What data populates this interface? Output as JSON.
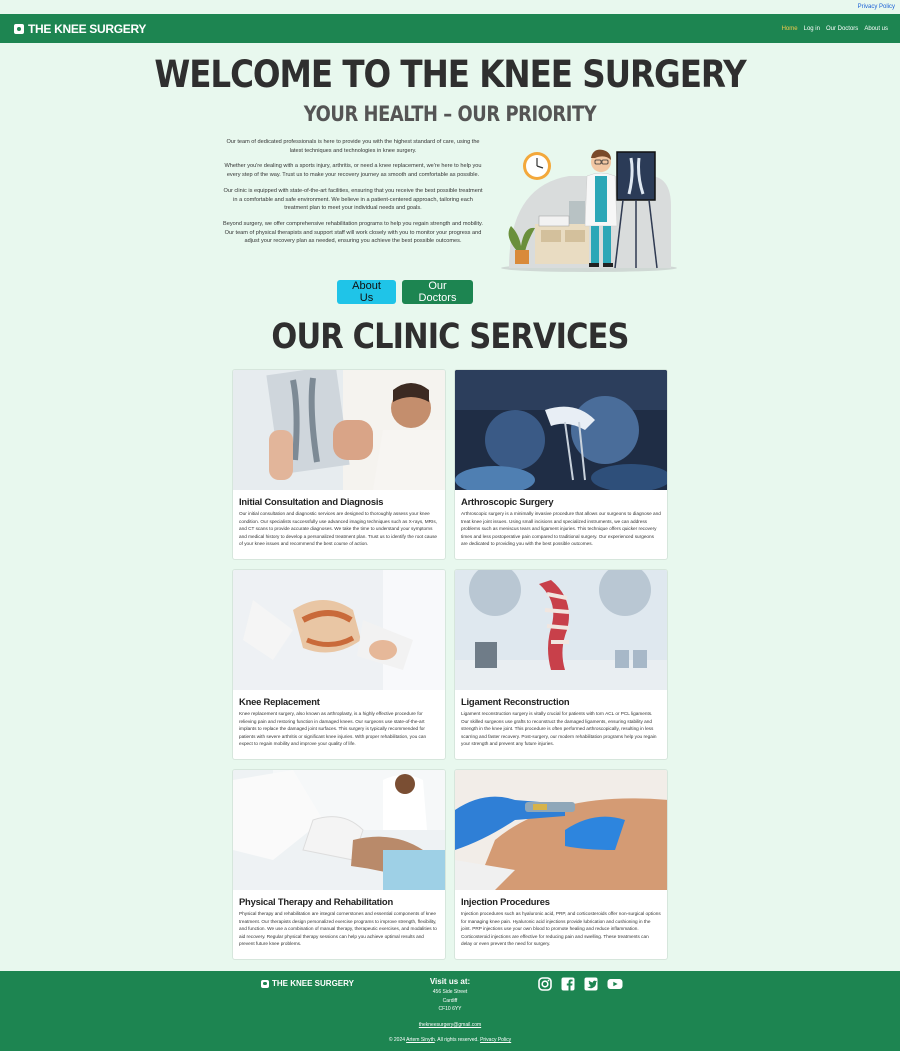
{
  "topbar": {
    "privacy": "Privacy Policy"
  },
  "nav": {
    "brand": "THE KNEE SURGERY",
    "links": [
      "Home",
      "Log in",
      "Our Doctors",
      "About us"
    ]
  },
  "hero": {
    "title": "WELCOME TO THE KNEE SURGERY",
    "subtitle": "YOUR HEALTH – OUR PRIORITY",
    "paragraphs": [
      "Our team of dedicated professionals is here to provide you with the highest standard of care, using the latest techniques and technologies in knee surgery.",
      "Whether you're dealing with a sports injury, arthritis, or need a knee replacement, we're here to help you every step of the way. Trust us to make your recovery journey as smooth and comfortable as possible.",
      "Our clinic is equipped with state-of-the-art facilities, ensuring that you receive the best possible treatment in a comfortable and safe environment. We believe in a patient-centered approach, tailoring each treatment plan to meet your individual needs and goals.",
      "Beyond surgery, we offer comprehensive rehabilitation programs to help you regain strength and mobility. Our team of physical therapists and support staff will work closely with you to monitor your progress and adjust your recovery plan as needed, ensuring you achieve the best possible outcomes."
    ],
    "btn_about": "About Us",
    "btn_doctors": "Our Doctors"
  },
  "services": {
    "title": "OUR CLINIC SERVICES",
    "cards": [
      {
        "title": "Initial Consultation and Diagnosis",
        "text": "Our initial consultation and diagnostic services are designed to thoroughly assess your knee condition. Our specialists successfully use advanced imaging techniques such as X-rays, MRIs, and CT scans to provide accurate diagnoses. We take the time to understand your symptoms and medical history to develop a personalized treatment plan. Trust us to identify the root cause of your knee issues and recommend the best course of action."
      },
      {
        "title": "Arthroscopic Surgery",
        "text": "Arthroscopic surgery is a minimally invasive procedure that allows our surgeons to diagnose and treat knee joint issues. Using small incisions and specialized instruments, we can address problems such as meniscus tears and ligament injuries. This technique offers quicker recovery times and less postoperative pain compared to traditional surgery. Our experienced surgeons are dedicated to providing you with the best possible outcomes."
      },
      {
        "title": "Knee Replacement",
        "text": "Knee replacement surgery, also known as arthroplasty, is a highly effective procedure for relieving pain and restoring function in damaged knees. Our surgeons use state-of-the-art implants to replace the damaged joint surfaces. This surgery is typically recommended for patients with severe arthritis or significant knee injuries. With proper rehabilitation, you can expect to regain mobility and improve your quality of life."
      },
      {
        "title": "Ligament Reconstruction",
        "text": "Ligament reconstruction surgery is vitally crucial for patients with torn ACL or PCL ligaments. Our skilled surgeons use grafts to reconstruct the damaged ligaments, ensuring stability and strength in the knee joint. This procedure is often performed arthroscopically, resulting in less scarring and faster recovery. Post-surgery, our modern rehabilitation programs help you regain your strength and prevent any future injuries."
      },
      {
        "title": "Physical Therapy and Rehabilitation",
        "text": "Physical therapy and rehabilitation are integral cornerstones and essential components of knee treatment. Our therapists design personalized exercise programs to improve strength, flexibility, and function. We use a combination of manual therapy, therapeutic exercises, and modalities to aid recovery. Regular physical therapy sessions can help you achieve optimal results and prevent future knee problems."
      },
      {
        "title": "Injection Procedures",
        "text": "Injection procedures such as hyaluronic acid, PRP, and corticosteroids offer non-surgical options for managing knee pain. Hyaluronic acid injections provide lubrication and cushioning in the joint. PRP injections use your own blood to promote healing and reduce inflammation. Corticosteroid injections are effective for reducing pain and swelling. These treatments can delay or even prevent the need for surgery."
      }
    ]
  },
  "footer": {
    "brand": "THE KNEE SURGERY",
    "visit_heading": "Visit us at:",
    "address": [
      "456 Side Street",
      "Cardiff",
      "CF10 6YY"
    ],
    "email": "thekneesurgery@gmail.com",
    "copy_prefix": "© 2024",
    "copy_author": "Artem Sinyth",
    "copy_mid": ". All rights reserved.",
    "copy_privacy": "Privacy Policy"
  },
  "colors": {
    "primary": "#1d8551",
    "accent": "#1fc4e8",
    "background": "#e8f8ee",
    "active_nav": "#f2c94c"
  }
}
